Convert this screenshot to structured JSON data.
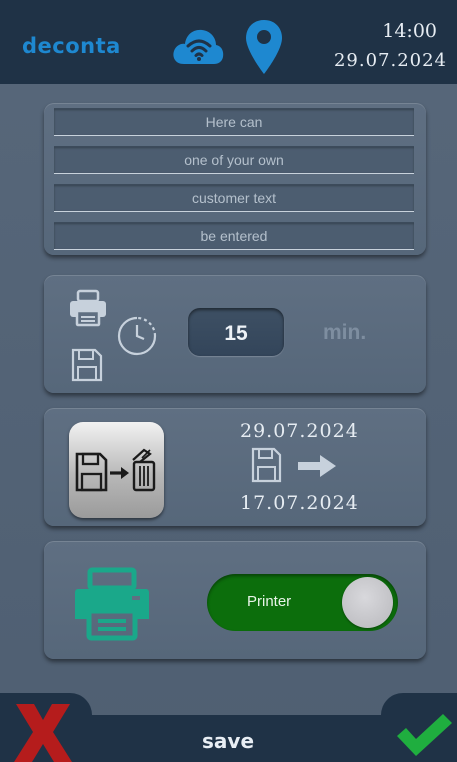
{
  "header": {
    "logo": "deconta",
    "time": "14:00",
    "date": "29.07.2024",
    "icons": [
      "cloud-wifi-icon",
      "location-pin-icon"
    ],
    "accent_color": "#1e88d0"
  },
  "customer_text": {
    "lines": [
      "Here can",
      "one of your own",
      "customer text",
      "be entered"
    ]
  },
  "interval": {
    "value": "15",
    "unit": "min.",
    "icons": [
      "printer-icon",
      "timer-icon",
      "floppy-disk-icon"
    ]
  },
  "archive": {
    "date_from": "29.07.2024",
    "date_to": "17.07.2024",
    "icons": [
      "save-delete-icon",
      "floppy-disk-icon",
      "arrow-right-icon"
    ]
  },
  "printer": {
    "toggle_label": "Printer",
    "toggle_on": true,
    "toggle_color": "#0c6e0c",
    "icon_color": "#1aa88a"
  },
  "footer": {
    "save_label": "save",
    "cancel_color": "#b51c1c",
    "confirm_color": "#1fae3f"
  }
}
